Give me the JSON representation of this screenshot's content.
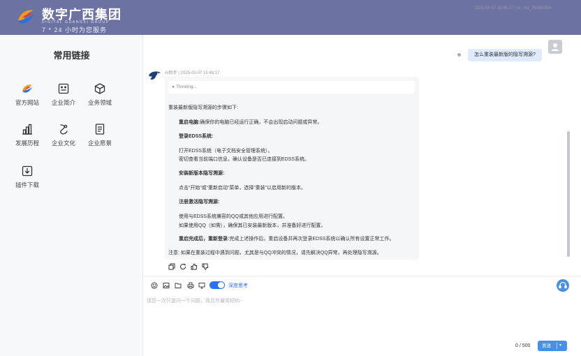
{
  "header": {
    "brand_title": "数字广西集团",
    "brand_subtitle": "DIGITAL GUANGXI GROUP",
    "brand_slogan": "7 * 24 小时为您服务"
  },
  "sidebar": {
    "title": "常用链接",
    "links": [
      {
        "label": "官方网站",
        "icon": "brand-logo-icon"
      },
      {
        "label": "企业简介",
        "icon": "id-card-icon"
      },
      {
        "label": "业务领域",
        "icon": "cube-icon"
      },
      {
        "label": "发展历程",
        "icon": "bar-chart-icon"
      },
      {
        "label": "企业文化",
        "icon": "culture-icon"
      },
      {
        "label": "企业愿景",
        "icon": "document-icon"
      },
      {
        "label": "插件下载",
        "icon": "download-icon"
      }
    ]
  },
  "chat": {
    "user_message": {
      "meta": "2025-03-07 15:48:17 | xc_ma_7N88h3BA",
      "text": "怎么重装最新版的隐写溯源?"
    },
    "ai_message": {
      "meta": "AI助手 | 2025-03-07 15:48:17",
      "thinking_label": "▸ Thinking...",
      "lines": [
        {
          "text": "重装最新版隐写溯源的步骤如下:",
          "bold": false,
          "indent": false
        },
        {
          "text": "重启电脑:",
          "bold": true,
          "indent": true,
          "suffix": "确保你的电脑已经运行正确，不会出现启动问题或异常。"
        },
        {
          "text": "登录EDSS系统:",
          "bold": true,
          "indent": true
        },
        {
          "text": "打开EDSS系统（电子文档安全管理系统）。",
          "bold": false,
          "indent": true
        },
        {
          "text": "密切查看当前端口信息，确认设备是否已连接到EDSS系统。",
          "bold": false,
          "indent": true
        },
        {
          "text": "安装新版本隐写溯源:",
          "bold": true,
          "indent": true
        },
        {
          "text": "点击“开始”或“重新启动”菜单，选择“重装”以启用新的版本。",
          "bold": false,
          "indent": true
        },
        {
          "text": "注册激活隐写溯源:",
          "bold": true,
          "indent": true
        },
        {
          "text": "使用与EDSS系统兼容的QQ或其他应用进行配置。",
          "bold": false,
          "indent": true
        },
        {
          "text": "如果使用QQ（如需），确保其已安装最新版本，并准备好进行配置。",
          "bold": false,
          "indent": true
        },
        {
          "text": "重启完成后，重新登录:",
          "bold": true,
          "indent": true,
          "suffix": "完成上述操作后，重启设备并再次登录EDSS系统以确认所有设置正常工作。"
        },
        {
          "text": "注意: 如果在重装过程中遇到问题，尤其是与QQ冲突的情况，请先解决QQ异常，再处理隐写溯源。",
          "bold": false,
          "indent": false
        }
      ]
    }
  },
  "composer": {
    "deep_think_label": "深度思考",
    "deep_think_on": true,
    "placeholder": "请您一次只提问一个问题，而且尽量简短哟~",
    "value": "",
    "char_count": "0 / 500",
    "send_label": "发送"
  },
  "colors": {
    "header_bg": "#6c73a3",
    "sidebar_bg": "#f7f8fa",
    "accent": "#4a90e2",
    "toggle_on": "#2f6fed",
    "user_bubble": "#dfeafb",
    "ai_card": "#f5f6f8"
  }
}
